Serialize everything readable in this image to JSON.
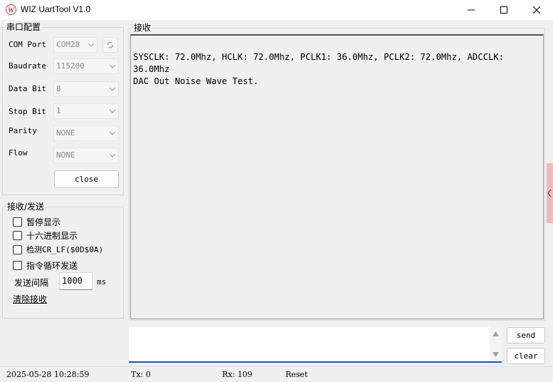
{
  "window": {
    "title": "WIZ UartTool V1.0",
    "logo_letter": "W"
  },
  "serial_config": {
    "group_title": "串口配置",
    "com_port_label": "COM Port",
    "com_port_value": "COM28",
    "baudrate_label": "Baudrate",
    "baudrate_value": "115200",
    "databit_label": "Data Bit",
    "databit_value": "8",
    "stopbit_label": "Stop Bit",
    "stopbit_value": "1",
    "parity_label": "Parity",
    "parity_value": "NONE",
    "flow_label": "Flow",
    "flow_value": "NONE",
    "close_button": "close"
  },
  "rx_tx": {
    "group_title": "接收/发送",
    "pause_display": "暂停显示",
    "hex_display": "十六进制显示",
    "detect_crlf": "检测CR_LF($0D$0A)",
    "loop_send": "指令循环发送",
    "interval_label": "发送间隔",
    "interval_value": "1000",
    "interval_unit": "ms",
    "clear_receive": "清除接收"
  },
  "receive": {
    "group_title": "接收",
    "lines": [
      "SYSCLK: 72.0Mhz, HCLK: 72.0Mhz, PCLK1: 36.0Mhz, PCLK2: 72.0Mhz, ADCCLK:",
      "36.0Mhz",
      "DAC Out Noise Wave Test."
    ]
  },
  "send": {
    "input_value": "",
    "send_button": "send",
    "clear_button": "clear"
  },
  "status": {
    "datetime": "2025-05-28 10:28:59",
    "tx": "Tx: 0",
    "rx": "Rx: 109",
    "reset": "Reset"
  }
}
